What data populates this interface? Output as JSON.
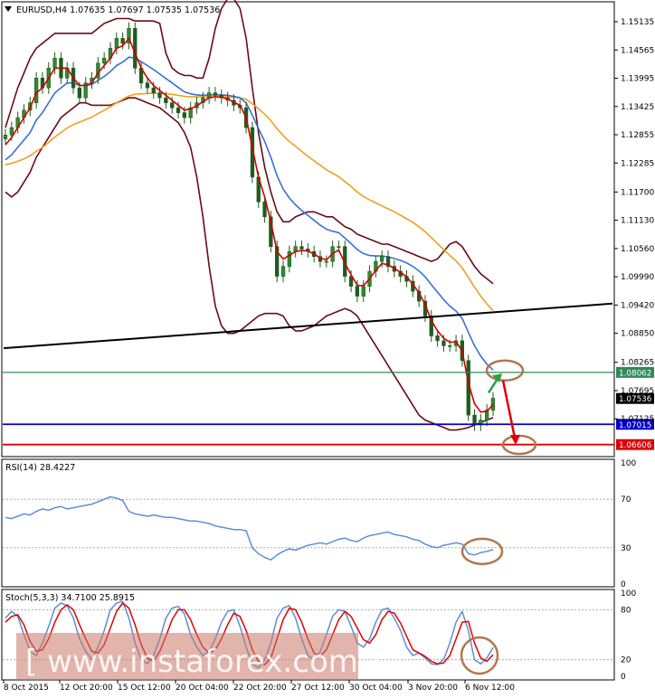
{
  "colors": {
    "background": "#ffffff",
    "frame": "#000000",
    "price_up": "#2e8b2e",
    "price_down": "#1f5c1f",
    "ema_fast": "#d00000",
    "ema_mid": "#3a6fd8",
    "ema_slow": "#f0a020",
    "bollinger": "#6b0b14",
    "trendline": "#000000",
    "resistance": "#2e8b57",
    "support_1": "#0000cc",
    "support_2": "#e00000",
    "rsi_line": "#5b8fd8",
    "stoch_main": "#5b8fd8",
    "stoch_signal": "#e00000",
    "annotation_circle": "#b07850",
    "arrow_up": "#2ea040",
    "arrow_down": "#e00000",
    "watermark": "#c87868"
  },
  "chart_data": [
    {
      "type": "candlestick",
      "title": "EURUSD,H4 1.07635 1.07697 1.07535 1.07536",
      "ylim": [
        1.064,
        1.155
      ],
      "y_ticks": [
        "1.15135",
        "1.14565",
        "1.13995",
        "1.13425",
        "1.12855",
        "1.12285",
        "1.11700",
        "1.11130",
        "1.10560",
        "1.09990",
        "1.09420",
        "1.08850",
        "1.08265",
        "1.07695",
        "1.07125"
      ],
      "x_labels": [
        "8 Oct 2015",
        "12 Oct 20:00",
        "15 Oct 12:00",
        "20 Oct 04:00",
        "22 Oct 20:00",
        "27 Oct 12:00",
        "30 Oct 04:00",
        "3 Nov 20:00",
        "6 Nov 12:00"
      ],
      "close_series": [
        1.1285,
        1.13,
        1.132,
        1.1335,
        1.135,
        1.14,
        1.138,
        1.142,
        1.144,
        1.14,
        1.142,
        1.138,
        1.136,
        1.139,
        1.14,
        1.143,
        1.144,
        1.146,
        1.148,
        1.147,
        1.15,
        1.142,
        1.139,
        1.138,
        1.137,
        1.136,
        1.135,
        1.134,
        1.133,
        1.132,
        1.134,
        1.135,
        1.136,
        1.137,
        1.1365,
        1.136,
        1.1355,
        1.1345,
        1.134,
        1.13,
        1.12,
        1.115,
        1.112,
        1.106,
        1.1,
        1.102,
        1.105,
        1.106,
        1.1055,
        1.105,
        1.104,
        1.103,
        1.103,
        1.106,
        1.106,
        1.1,
        1.098,
        1.096,
        1.098,
        1.101,
        1.103,
        1.104,
        1.102,
        1.101,
        1.1,
        1.099,
        1.097,
        1.095,
        1.092,
        1.088,
        1.087,
        1.086,
        1.086,
        1.087,
        1.083,
        1.072,
        1.07,
        1.071,
        1.073,
        1.0754
      ],
      "ema_fast": [
        1.1265,
        1.128,
        1.13,
        1.132,
        1.134,
        1.137,
        1.138,
        1.14,
        1.142,
        1.142,
        1.142,
        1.14,
        1.1385,
        1.1385,
        1.139,
        1.141,
        1.1425,
        1.144,
        1.146,
        1.1465,
        1.148,
        1.145,
        1.142,
        1.14,
        1.1385,
        1.1375,
        1.1365,
        1.1355,
        1.1345,
        1.1335,
        1.1338,
        1.1344,
        1.1352,
        1.136,
        1.1362,
        1.1361,
        1.1358,
        1.1351,
        1.1345,
        1.132,
        1.126,
        1.12,
        1.116,
        1.111,
        1.105,
        1.1035,
        1.1042,
        1.105,
        1.1052,
        1.1051,
        1.1045,
        1.1037,
        1.1033,
        1.1046,
        1.1053,
        1.1026,
        1.1003,
        1.0982,
        1.0981,
        1.0995,
        1.1012,
        1.1026,
        1.1023,
        1.1016,
        1.1008,
        1.0999,
        1.0984,
        1.0967,
        1.0943,
        1.0911,
        1.089,
        1.0875,
        1.0867,
        1.0868,
        1.0849,
        1.0785,
        1.0743,
        1.0726,
        1.0728,
        1.0741
      ],
      "ema_mid": [
        1.1235,
        1.1245,
        1.126,
        1.1275,
        1.129,
        1.1315,
        1.133,
        1.135,
        1.137,
        1.138,
        1.139,
        1.139,
        1.1385,
        1.1385,
        1.1387,
        1.1395,
        1.1403,
        1.1413,
        1.1425,
        1.1432,
        1.1442,
        1.144,
        1.1433,
        1.1425,
        1.1417,
        1.1408,
        1.1399,
        1.139,
        1.1381,
        1.1372,
        1.1368,
        1.1366,
        1.1365,
        1.1366,
        1.1366,
        1.1366,
        1.1365,
        1.1363,
        1.136,
        1.135,
        1.1325,
        1.1298,
        1.1272,
        1.124,
        1.1203,
        1.1176,
        1.1158,
        1.1144,
        1.1133,
        1.1123,
        1.1113,
        1.1103,
        1.1095,
        1.1091,
        1.1088,
        1.1077,
        1.1066,
        1.1054,
        1.1046,
        1.1042,
        1.1041,
        1.1041,
        1.1039,
        1.1036,
        1.1032,
        1.1027,
        1.102,
        1.1011,
        1.0999,
        1.0983,
        1.0968,
        1.0953,
        1.094,
        1.093,
        1.0915,
        1.0887,
        1.086,
        1.0839,
        1.0823,
        1.0811
      ],
      "ema_slow": [
        1.1225,
        1.1228,
        1.1232,
        1.1237,
        1.1243,
        1.1252,
        1.126,
        1.127,
        1.1281,
        1.129,
        1.1299,
        1.1306,
        1.1311,
        1.1316,
        1.1321,
        1.1328,
        1.1335,
        1.1342,
        1.135,
        1.1357,
        1.1364,
        1.1367,
        1.1368,
        1.1369,
        1.1369,
        1.1369,
        1.1368,
        1.1367,
        1.1365,
        1.1363,
        1.1362,
        1.1362,
        1.1362,
        1.1362,
        1.1362,
        1.1362,
        1.1362,
        1.1361,
        1.136,
        1.1357,
        1.1348,
        1.1338,
        1.1327,
        1.1314,
        1.1298,
        1.1284,
        1.1272,
        1.1262,
        1.1252,
        1.1242,
        1.1233,
        1.1224,
        1.1215,
        1.1208,
        1.1201,
        1.1191,
        1.1181,
        1.117,
        1.1161,
        1.1154,
        1.1148,
        1.1142,
        1.1136,
        1.113,
        1.1123,
        1.1116,
        1.1109,
        1.11,
        1.109,
        1.1078,
        1.1066,
        1.1054,
        1.1042,
        1.1031,
        1.1017,
        1.0998,
        1.0978,
        1.096,
        1.0944,
        1.0931
      ],
      "bollinger_upper": [
        1.13,
        1.134,
        1.138,
        1.141,
        1.144,
        1.146,
        1.147,
        1.148,
        1.149,
        1.149,
        1.149,
        1.149,
        1.149,
        1.149,
        1.149,
        1.15,
        1.151,
        1.1515,
        1.152,
        1.152,
        1.152,
        1.1515,
        1.1515,
        1.1515,
        1.1515,
        1.151,
        1.145,
        1.142,
        1.141,
        1.1405,
        1.1405,
        1.14,
        1.14,
        1.144,
        1.15,
        1.154,
        1.156,
        1.156,
        1.154,
        1.148,
        1.138,
        1.129,
        1.122,
        1.117,
        1.113,
        1.111,
        1.111,
        1.112,
        1.1125,
        1.113,
        1.113,
        1.1125,
        1.112,
        1.112,
        1.111,
        1.11,
        1.1095,
        1.1085,
        1.108,
        1.1075,
        1.107,
        1.1065,
        1.1065,
        1.106,
        1.1055,
        1.105,
        1.1045,
        1.104,
        1.1035,
        1.103,
        1.1035,
        1.105,
        1.1065,
        1.107,
        1.106,
        1.104,
        1.102,
        1.1005,
        1.0995,
        1.0985
      ],
      "bollinger_lower": [
        1.117,
        1.116,
        1.117,
        1.119,
        1.121,
        1.124,
        1.126,
        1.128,
        1.13,
        1.132,
        1.133,
        1.134,
        1.135,
        1.135,
        1.1345,
        1.1345,
        1.1345,
        1.1345,
        1.135,
        1.1355,
        1.136,
        1.136,
        1.1355,
        1.135,
        1.1345,
        1.134,
        1.133,
        1.132,
        1.131,
        1.129,
        1.126,
        1.12,
        1.112,
        1.102,
        1.094,
        1.09,
        1.0885,
        1.0885,
        1.089,
        1.09,
        1.091,
        1.092,
        1.0925,
        1.0925,
        1.0925,
        1.092,
        1.09,
        1.089,
        1.089,
        1.0895,
        1.09,
        1.091,
        1.092,
        1.0925,
        1.093,
        1.0935,
        1.093,
        1.092,
        1.09,
        1.088,
        1.086,
        1.084,
        1.082,
        1.08,
        1.078,
        1.076,
        1.074,
        1.072,
        1.071,
        1.0705,
        1.07,
        1.0695,
        1.069,
        1.069,
        1.0692,
        1.0695,
        1.07,
        1.0705,
        1.071,
        1.0715
      ],
      "trendline": {
        "start": 1.0855,
        "end": 1.0945
      },
      "levels": [
        {
          "name": "resistance",
          "value": "1.08062",
          "y": 1.08062
        },
        {
          "name": "support_1",
          "value": "1.07015",
          "y": 1.07015
        },
        {
          "name": "support_2",
          "value": "1.06606",
          "y": 1.06606
        }
      ],
      "current_price": "1.07536",
      "current_price_value": 1.07536
    },
    {
      "type": "line",
      "title": "RSI(14) 28.4227",
      "ylim": [
        0,
        100
      ],
      "y_ticks": [
        "100",
        "70",
        "30",
        "0"
      ],
      "levels": [
        70,
        30
      ],
      "values": [
        55,
        54,
        56,
        58,
        57,
        60,
        62,
        61,
        63,
        64,
        62,
        63,
        64,
        65,
        66,
        68,
        70,
        72,
        71,
        69,
        60,
        58,
        57,
        56,
        57,
        56,
        55,
        55,
        54,
        53,
        52,
        52,
        51,
        50,
        48,
        47,
        46,
        45,
        45,
        44,
        30,
        25,
        22,
        20,
        24,
        27,
        29,
        28,
        30,
        32,
        33,
        34,
        33,
        35,
        37,
        38,
        36,
        35,
        38,
        40,
        41,
        42,
        43,
        41,
        40,
        39,
        37,
        36,
        33,
        31,
        30,
        32,
        33,
        34,
        33,
        25,
        24,
        26,
        27,
        28.4
      ]
    },
    {
      "type": "line",
      "title": "Stoch(5,3,3) 34.7100 25.8915",
      "ylim": [
        0,
        100
      ],
      "y_ticks": [
        "100",
        "80",
        "20",
        "0"
      ],
      "levels": [
        80,
        20
      ],
      "series": [
        {
          "values": [
            70,
            78,
            72,
            50,
            30,
            25,
            40,
            60,
            82,
            88,
            85,
            70,
            45,
            30,
            20,
            35,
            55,
            80,
            88,
            90,
            70,
            40,
            20,
            15,
            25,
            45,
            70,
            82,
            84,
            75,
            50,
            35,
            25,
            30,
            45,
            65,
            78,
            80,
            60,
            35,
            15,
            10,
            20,
            40,
            70,
            82,
            85,
            70,
            45,
            25,
            20,
            30,
            50,
            72,
            80,
            78,
            60,
            40,
            35,
            45,
            65,
            80,
            82,
            70,
            55,
            35,
            25,
            28,
            22,
            15,
            14,
            20,
            40,
            65,
            78,
            55,
            20,
            15,
            22,
            34.71
          ]
        },
        {
          "values": [
            65,
            72,
            74,
            62,
            42,
            30,
            32,
            45,
            65,
            80,
            86,
            80,
            62,
            45,
            30,
            28,
            38,
            58,
            78,
            88,
            82,
            62,
            38,
            22,
            18,
            30,
            48,
            68,
            80,
            80,
            68,
            50,
            35,
            28,
            32,
            45,
            62,
            76,
            72,
            55,
            32,
            18,
            14,
            22,
            45,
            68,
            82,
            80,
            65,
            45,
            28,
            24,
            32,
            50,
            68,
            78,
            72,
            58,
            44,
            40,
            50,
            68,
            78,
            76,
            64,
            48,
            32,
            28,
            24,
            18,
            15,
            16,
            25,
            45,
            65,
            66,
            40,
            22,
            18,
            25.89
          ]
        }
      ]
    }
  ],
  "watermark_text": "[ www.instaforex.com ]"
}
